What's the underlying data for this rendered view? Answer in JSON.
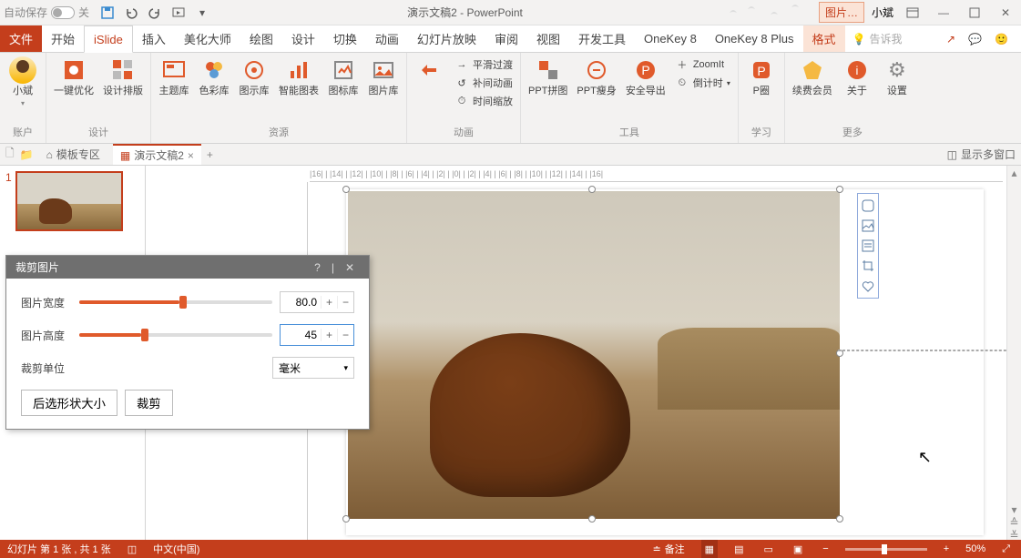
{
  "titlebar": {
    "autosave_label": "自动保存",
    "autosave_state": "关",
    "title": "演示文稿2 - PowerPoint",
    "picture_tools_tab": "图片…",
    "username": "小斌"
  },
  "ribbon_tabs": {
    "file": "文件",
    "home": "开始",
    "islide": "iSlide",
    "insert": "插入",
    "meihua": "美化大师",
    "draw": "绘图",
    "design": "设计",
    "transition": "切换",
    "animation": "动画",
    "slideshow": "幻灯片放映",
    "review": "审阅",
    "view": "视图",
    "dev": "开发工具",
    "onekey8": "OneKey 8",
    "onekey8p": "OneKey 8 Plus",
    "format": "格式",
    "tellme": "告诉我"
  },
  "ribbon": {
    "account": {
      "name": "小斌",
      "group": "账户"
    },
    "design_group": {
      "opt1": "一键优化",
      "opt2": "设计排版",
      "group": "设计"
    },
    "resource_group": {
      "theme": "主题库",
      "color": "色彩库",
      "icon": "图示库",
      "smart": "智能图表",
      "iconlib": "图标库",
      "piclib": "图片库",
      "group": "资源"
    },
    "anim_group": {
      "smooth": "平滑过渡",
      "supp": "补间动画",
      "time": "时间缩放",
      "group": "动画"
    },
    "tool_group": {
      "pptpin": "PPT拼图",
      "pptslim": "PPT瘦身",
      "export": "安全导出",
      "zoomit": "ZoomIt",
      "countdown": "倒计时",
      "group": "工具"
    },
    "learn_group": {
      "pquan": "P圈",
      "group": "学习"
    },
    "more_group": {
      "renew": "续费会员",
      "about": "关于",
      "settings": "设置",
      "group": "更多"
    }
  },
  "doc_tabs": {
    "templates": "模板专区",
    "doc": "演示文稿2",
    "multi_window": "显示多窗口"
  },
  "ruler_text": "  |16|  |  |14|  |  |12|  |  |10|  |  |8|  |  |6|  |  |4|  |  |2|  |  |0|  |  |2|  |  |4|  |  |6|  |  |8|  |  |10|  |  |12|  |  |14|  |  |16|  ",
  "thumb": {
    "num": "1"
  },
  "crop_panel": {
    "title": "裁剪图片",
    "width_label": "图片宽度",
    "width_value": "80.0",
    "height_label": "图片高度",
    "height_value": "45",
    "unit_label": "裁剪单位",
    "unit_value": "毫米",
    "btn_after": "后选形状大小",
    "btn_crop": "裁剪",
    "width_fill_pct": 52,
    "height_fill_pct": 32
  },
  "statusbar": {
    "slide_info": "幻灯片 第 1 张 , 共 1 张",
    "lang": "中文(中国)",
    "notes": "备注",
    "zoom": "50%"
  }
}
